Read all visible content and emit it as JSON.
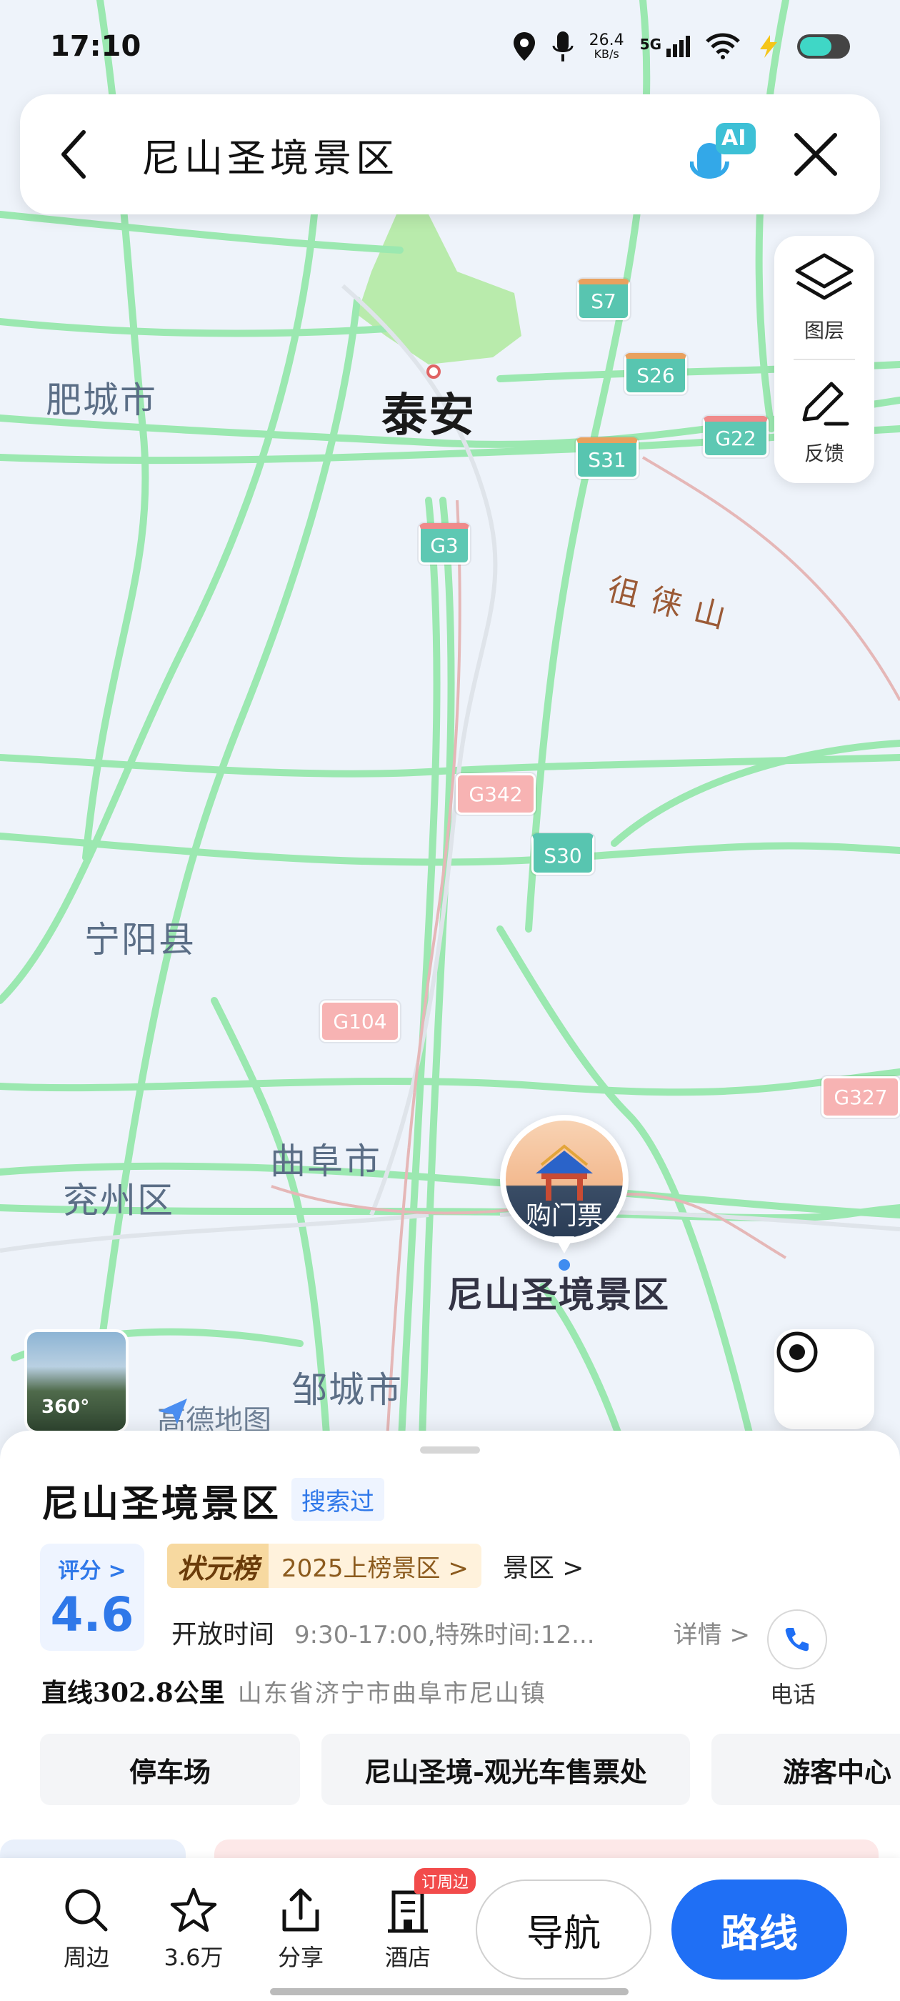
{
  "status_bar": {
    "time": "17:10",
    "net_speed_value": "26.4",
    "net_speed_unit": "KB/s",
    "network": "5G"
  },
  "search": {
    "query": "尼山圣境景区",
    "ai_badge": "AI"
  },
  "map_controls": {
    "layers_label": "图层",
    "feedback_label": "反馈"
  },
  "map": {
    "places": {
      "feicheng": "肥城市",
      "taian": "泰安",
      "culaishan": "徂徕山",
      "ningyang": "宁阳县",
      "qufu": "曲阜市",
      "yanzhou": "兖州区",
      "zoucheng": "邹城市",
      "poi": "尼山圣境景区"
    },
    "shields": {
      "s7": "S7",
      "s26": "S26",
      "s31": "S31",
      "g22": "G22",
      "g3": "G3",
      "g342": "G342",
      "s30": "S30",
      "g104": "G104",
      "g327": "G327"
    },
    "pin_label": "购门票",
    "pano_label": "360°",
    "brand": "高德地图"
  },
  "poi": {
    "title": "尼山圣境景区",
    "searched_badge": "搜索过",
    "rating_label": "评分 >",
    "rating_value": "4.6",
    "rank_logo": "状元榜",
    "rank_text": "2025上榜景区 >",
    "type": "景区 >",
    "hours_label": "开放时间",
    "hours_value": "9:30-17:00,特殊时间:12...",
    "detail_label": "详情 >",
    "phone_label": "电话",
    "distance": "直线302.8公里",
    "address": "山东省济宁市曲阜市尼山镇",
    "chips": [
      "停车场",
      "尼山圣境-观光车售票处",
      "游客中心"
    ]
  },
  "bottom_bar": {
    "nearby": "周边",
    "favorites": "3.6万",
    "share": "分享",
    "hotel": "酒店",
    "hotel_tag": "订周边",
    "navigate": "导航",
    "route": "路线"
  },
  "colors": {
    "accent_blue": "#1f6ff5",
    "road_green": "#8ee6a6",
    "rail_red": "#d9a3a3"
  }
}
